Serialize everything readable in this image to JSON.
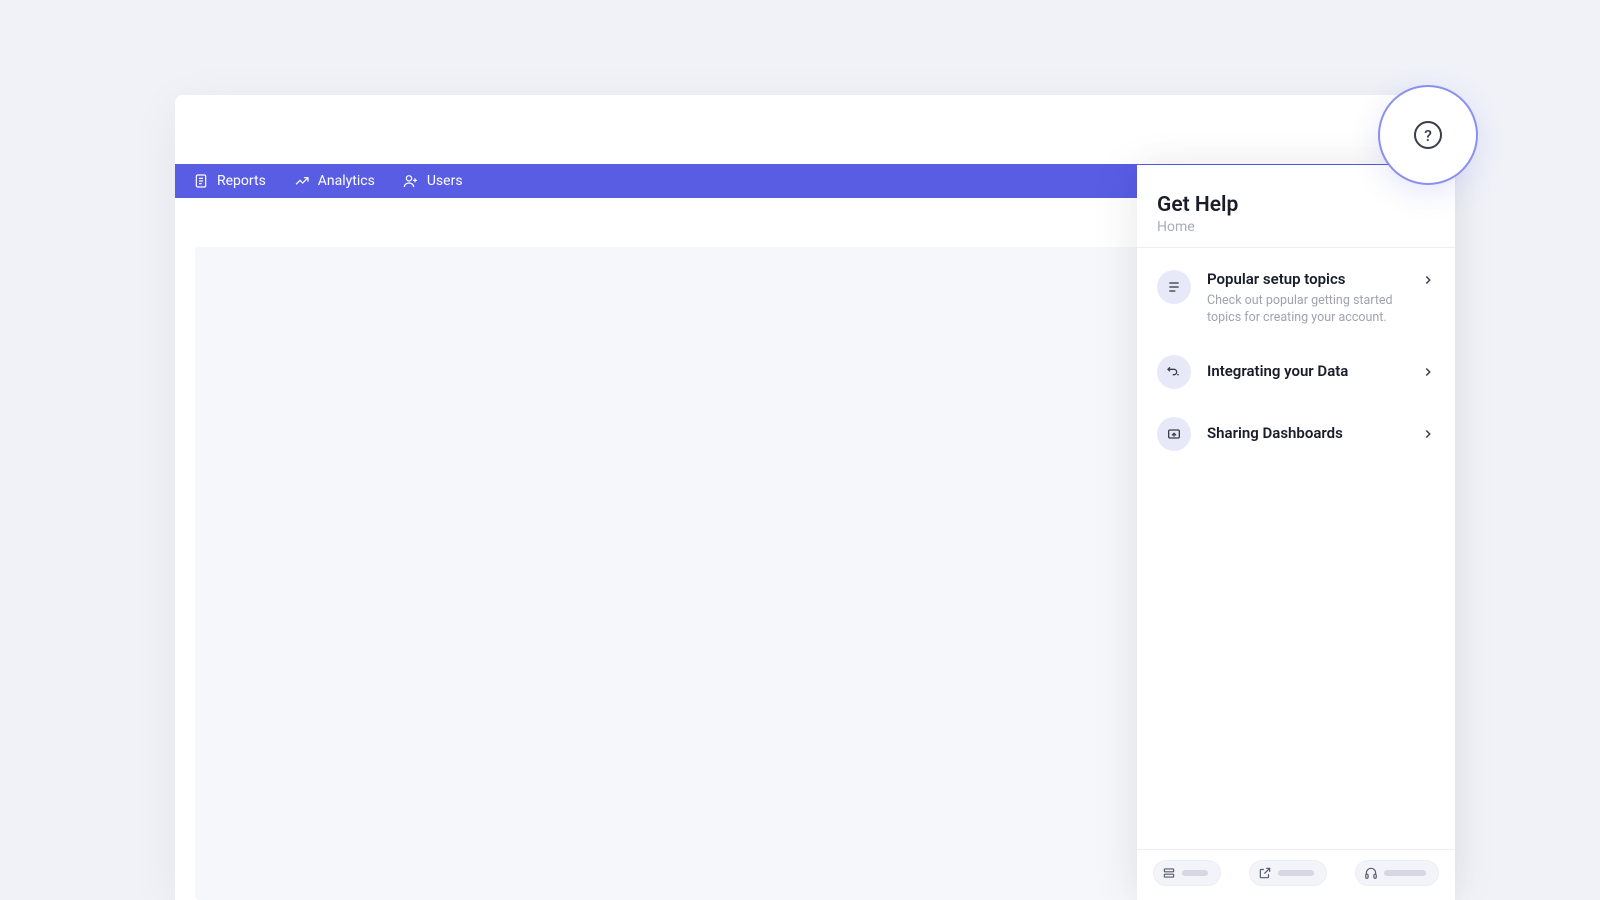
{
  "nav": {
    "items": [
      {
        "label": "Reports"
      },
      {
        "label": "Analytics"
      },
      {
        "label": "Users"
      }
    ]
  },
  "help": {
    "title": "Get Help",
    "breadcrumb": "Home",
    "items": [
      {
        "title": "Popular setup topics",
        "desc": "Check out popular getting started topics for creating your account."
      },
      {
        "title": "Integrating your Data"
      },
      {
        "title": "Sharing Dashboards"
      }
    ]
  },
  "colors": {
    "accent": "#585de4",
    "background": "#f0f2f8"
  }
}
